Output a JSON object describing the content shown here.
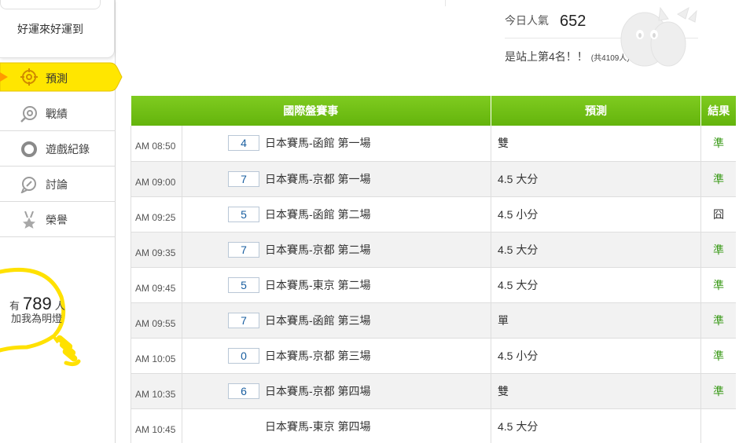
{
  "sidebar": {
    "slogan": "好運來好運到",
    "nav": [
      {
        "label": "預測",
        "icon": "target-icon",
        "active": true
      },
      {
        "label": "戰績",
        "icon": "record-icon",
        "active": false
      },
      {
        "label": "遊戲紀錄",
        "icon": "circle-icon",
        "active": false
      },
      {
        "label": "討論",
        "icon": "discussion-icon",
        "active": false
      },
      {
        "label": "榮譽",
        "icon": "medal-icon",
        "active": false
      }
    ],
    "fans": {
      "prefix": "有",
      "count": "789",
      "suffix": "人",
      "cta": "加我為明燈"
    }
  },
  "stats": {
    "popular_label": "今日人氣",
    "popular_count": "652",
    "rank_text": "是站上第4名！！",
    "rank_total": "(共4109人)"
  },
  "table": {
    "headers": [
      "國際盤賽事",
      "預測",
      "結果"
    ],
    "rows": [
      {
        "time": "AM 08:50",
        "num": "4",
        "match": "日本賽馬-函館 第一場",
        "prediction": "雙",
        "result": "準"
      },
      {
        "time": "AM 09:00",
        "num": "7",
        "match": "日本賽馬-京都 第一場",
        "prediction": "4.5 大分",
        "result": "準"
      },
      {
        "time": "AM 09:25",
        "num": "5",
        "match": "日本賽馬-函館 第二場",
        "prediction": "4.5 小分",
        "result": "囧"
      },
      {
        "time": "AM 09:35",
        "num": "7",
        "match": "日本賽馬-京都 第二場",
        "prediction": "4.5 大分",
        "result": "準"
      },
      {
        "time": "AM 09:45",
        "num": "5",
        "match": "日本賽馬-東京 第二場",
        "prediction": "4.5 大分",
        "result": "準"
      },
      {
        "time": "AM 09:55",
        "num": "7",
        "match": "日本賽馬-函館 第三場",
        "prediction": "單",
        "result": "準"
      },
      {
        "time": "AM 10:05",
        "num": "0",
        "match": "日本賽馬-京都 第三場",
        "prediction": "4.5 小分",
        "result": "準"
      },
      {
        "time": "AM 10:35",
        "num": "6",
        "match": "日本賽馬-京都 第四場",
        "prediction": "雙",
        "result": "準"
      },
      {
        "time": "AM 10:45",
        "num": "",
        "match": "日本賽馬-東京 第四場",
        "prediction": "4.5 大分",
        "result": ""
      }
    ]
  },
  "colors": {
    "header_green": "#72c016",
    "active_yellow": "#ffe600",
    "ok_green": "#3a9a18",
    "number_blue": "#1a5fa0"
  }
}
